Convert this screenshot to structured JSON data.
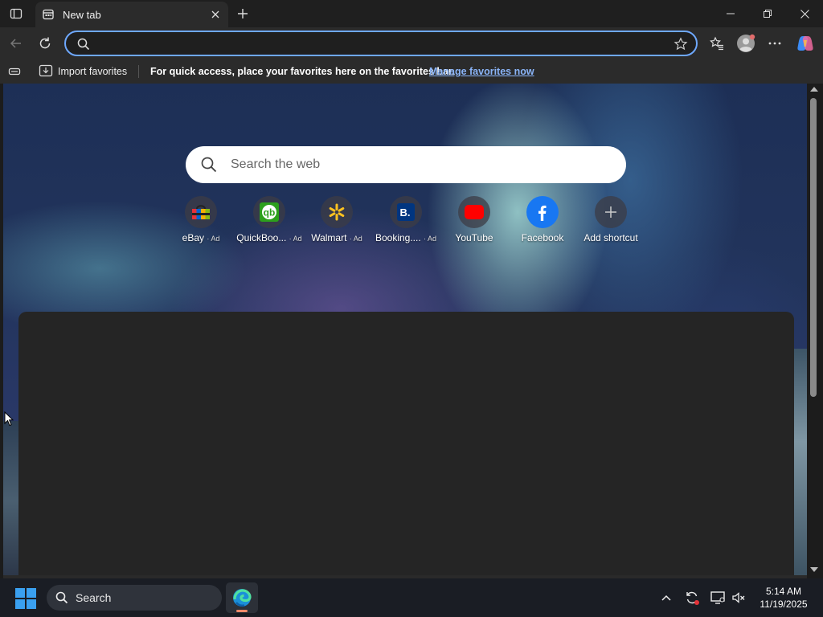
{
  "browser": {
    "tab": {
      "title": "New tab"
    },
    "address_bar": {
      "value": "",
      "placeholder": ""
    },
    "favorites_bar": {
      "import_label": "Import favorites",
      "message": "For quick access, place your favorites here on the favorites bar.",
      "manage_link": "Manage favorites now"
    }
  },
  "new_tab_page": {
    "search": {
      "placeholder": "Search the web"
    },
    "shortcuts": [
      {
        "label": "eBay",
        "ad": "· Ad",
        "icon": "ebay-icon"
      },
      {
        "label": "QuickBoo...",
        "ad": "· Ad",
        "icon": "quickbooks-icon"
      },
      {
        "label": "Walmart",
        "ad": "· Ad",
        "icon": "walmart-icon"
      },
      {
        "label": "Booking....",
        "ad": "· Ad",
        "icon": "booking-icon"
      },
      {
        "label": "YouTube",
        "ad": "",
        "icon": "youtube-icon"
      },
      {
        "label": "Facebook",
        "ad": "",
        "icon": "facebook-icon"
      },
      {
        "label": "Add shortcut",
        "ad": "",
        "icon": "plus-icon"
      }
    ]
  },
  "taskbar": {
    "search_label": "Search",
    "time": "5:14 AM",
    "date": "11/19/2025"
  },
  "colors": {
    "accent": "#6ea8fe",
    "link": "#8ab4f8",
    "chrome_bg": "#2b2b2b",
    "taskbar_bg": "#1a1d24"
  }
}
